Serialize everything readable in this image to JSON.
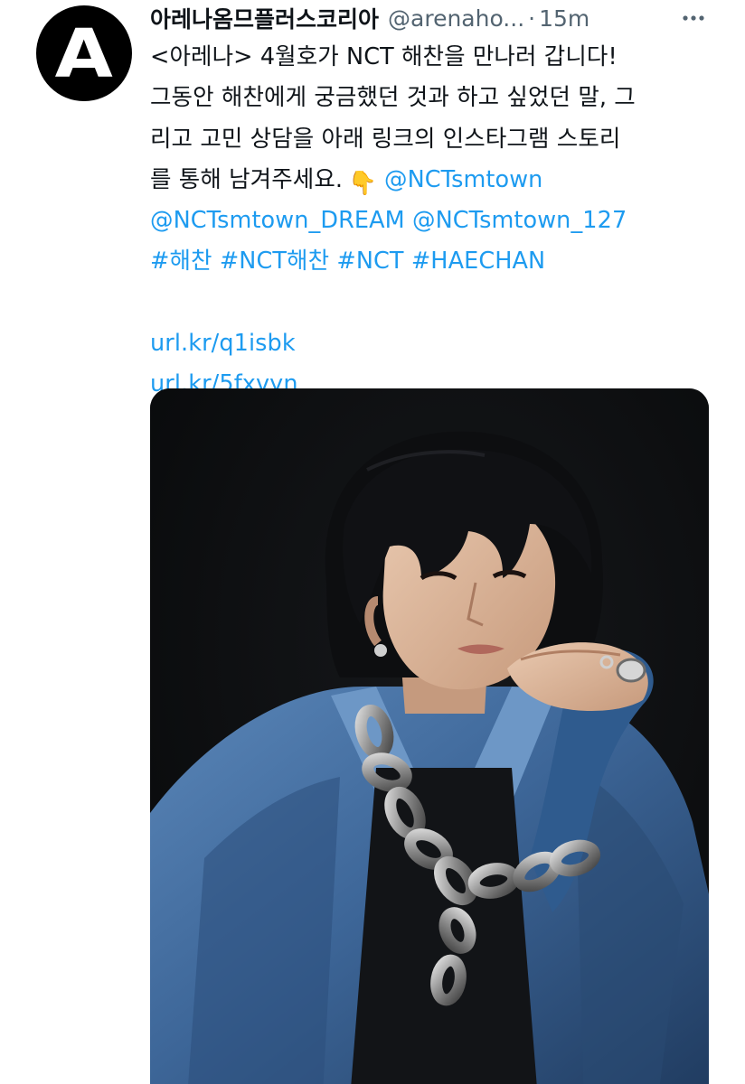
{
  "author": {
    "avatar_letter": "A",
    "display_name": "아레나옴므플러스코리아",
    "handle": "@arenaho...",
    "separator": "·",
    "time": "15m"
  },
  "more_menu": {
    "icon": "more-icon"
  },
  "tweet": {
    "line1": "<아레나> 4월호가 NCT 해찬을 만나러 갑니다!",
    "line2": "그동안 해찬에게 궁금했던 것과 하고 싶었던 말, 그",
    "line3": "리고 고민 상담을 아래 링크의 인스타그램 스토리",
    "line4_text": "를 통해 남겨주세요.",
    "pointing_emoji": "👇",
    "mention1": "@NCTsmtown",
    "mention2": "@NCTsmtown_DREAM",
    "mention3": "@NCTsmtown_127",
    "hashtag1": "#해찬",
    "hashtag2": "#NCT해찬",
    "hashtag3": "#NCT",
    "hashtag4": "#HAECHAN",
    "link1": "url.kr/q1isbk",
    "link2": "url.kr/5fxvyn"
  },
  "media": {
    "kind": "photo",
    "subject": "person-in-blue-jacket-with-chain"
  },
  "colors": {
    "link": "#1d9bf0",
    "text": "#0f1419",
    "secondary": "#536471",
    "background": "#ffffff"
  }
}
